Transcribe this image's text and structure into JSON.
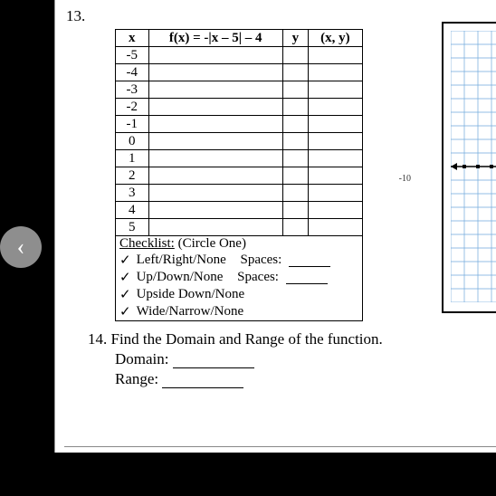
{
  "problem13": {
    "number": "13.",
    "headers": {
      "x": "x",
      "fx": "f(x) = -|x – 5| – 4",
      "y": "y",
      "xy": "(x, y)"
    },
    "x_values": [
      "-5",
      "-4",
      "-3",
      "-2",
      "-1",
      "0",
      "1",
      "2",
      "3",
      "4",
      "5"
    ],
    "checklist": {
      "title": "Checklist:",
      "hint": "(Circle One)",
      "items": [
        {
          "mark": "✓",
          "text": "Left/Right/None",
          "spaces_label": "Spaces:"
        },
        {
          "mark": "✓",
          "text": "Up/Down/None",
          "spaces_label": "Spaces:"
        },
        {
          "mark": "✓",
          "text": "Upside Down/None"
        },
        {
          "mark": "✓",
          "text": "Wide/Narrow/None"
        }
      ]
    }
  },
  "problem14": {
    "number": "14.",
    "prompt": "Find the Domain and Range of the function.",
    "domain_label": "Domain:",
    "range_label": "Range:"
  },
  "axis_label": "-10",
  "back_icon": "‹"
}
